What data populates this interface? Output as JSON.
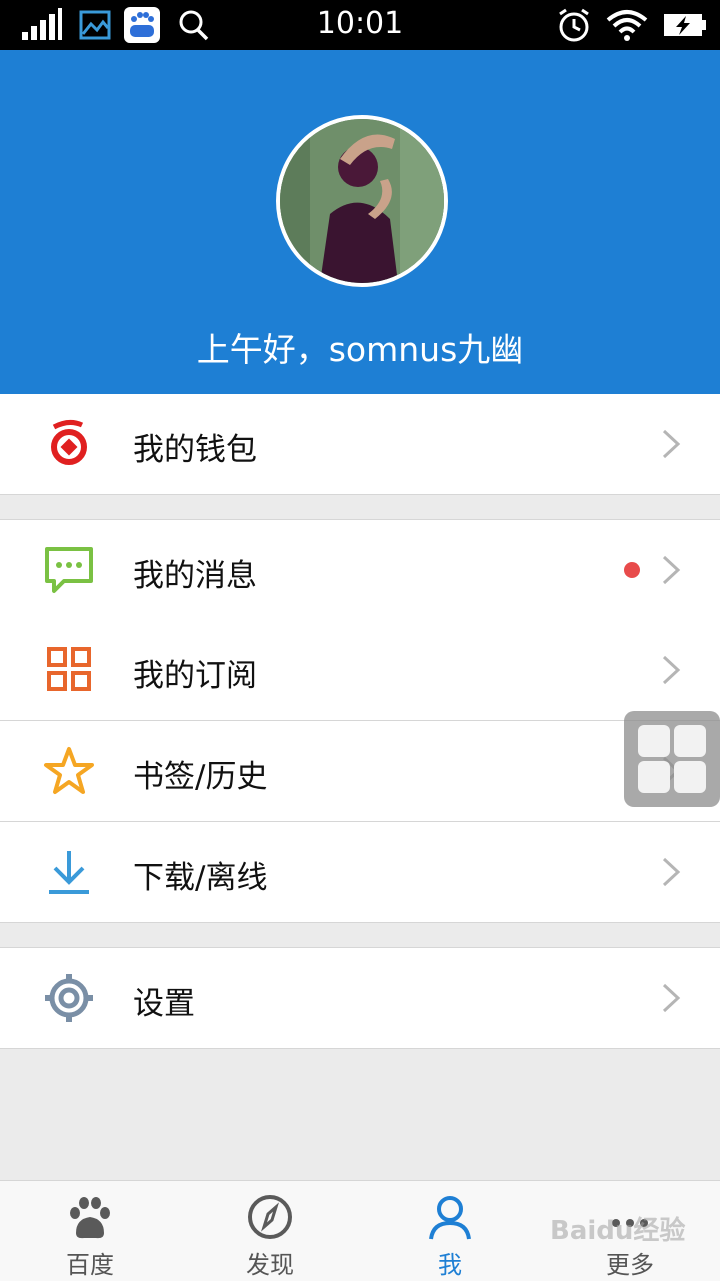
{
  "status_bar": {
    "time": "10:01",
    "icons": [
      "signal-icon",
      "image-icon",
      "baidu-app-icon",
      "search-icon",
      "alarm-icon",
      "wifi-icon",
      "battery-charging-icon"
    ]
  },
  "profile": {
    "greeting": "上午好，somnus九幽"
  },
  "menu": {
    "wallet": {
      "label": "我的钱包",
      "icon": "wallet-icon",
      "color": "#e02020"
    },
    "messages": {
      "label": "我的消息",
      "icon": "message-icon",
      "color": "#7ac143",
      "has_new": true
    },
    "subscriptions": {
      "label": "我的订阅",
      "icon": "grid-icon",
      "color": "#e8662c"
    },
    "bookmarks": {
      "label": "书签/历史",
      "icon": "star-icon",
      "color": "#f5a623"
    },
    "downloads": {
      "label": "下载/离线",
      "icon": "download-icon",
      "color": "#3a9ad9"
    },
    "settings": {
      "label": "设置",
      "icon": "gear-icon",
      "color": "#7a8fa6"
    }
  },
  "tabs": [
    {
      "label": "百度",
      "icon": "baidu-paw-icon",
      "active": false
    },
    {
      "label": "发现",
      "icon": "compass-icon",
      "active": false
    },
    {
      "label": "我",
      "icon": "person-icon",
      "active": true
    },
    {
      "label": "更多",
      "icon": "more-icon",
      "active": false
    }
  ],
  "watermark": {
    "text": "Baidu经验"
  },
  "colors": {
    "header": "#1e7fd4",
    "active_tab": "#1e7fd4",
    "badge": "#e84b4b"
  }
}
